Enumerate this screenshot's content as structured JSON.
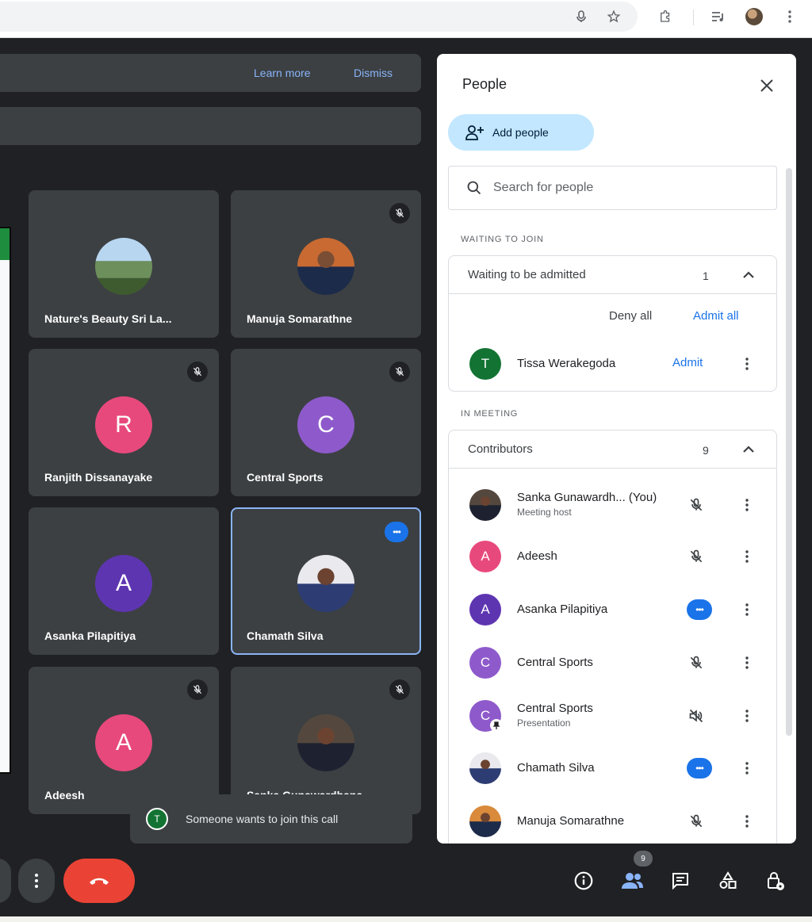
{
  "browser": {
    "icons": [
      "microphone-icon",
      "star-icon",
      "extensions-icon",
      "media-controls-icon",
      "profile-avatar",
      "menu-kebab-icon"
    ]
  },
  "banner": {
    "learn_more": "Learn more",
    "dismiss": "Dismiss"
  },
  "tiles": [
    {
      "name": "Nature's Beauty Sri La...",
      "avatar": "photo",
      "muted": false
    },
    {
      "name": "Manuja Somarathne",
      "avatar": "photo",
      "muted": true
    },
    {
      "name": "Ranjith Dissanayake",
      "initial": "R",
      "color": "#e8497c",
      "muted": true
    },
    {
      "name": "Central Sports",
      "initial": "C",
      "color": "#8e5acb",
      "muted": true
    },
    {
      "name": "Asanka Pilapitiya",
      "initial": "A",
      "color": "#5e35b1",
      "muted": false
    },
    {
      "name": "Chamath Silva",
      "avatar": "photo",
      "speaking": true,
      "active": true
    },
    {
      "name": "Adeesh",
      "initial": "A",
      "color": "#e8497c",
      "muted": true
    },
    {
      "name": "Sanka Gunawardhana",
      "avatar": "photo",
      "muted": true
    }
  ],
  "toast": {
    "initial": "T",
    "text": "Someone wants to join this call"
  },
  "controls": {
    "people_count": "9",
    "icons": [
      "info-icon",
      "people-icon",
      "chat-icon",
      "activities-icon",
      "host-controls-icon"
    ],
    "end_call_color": "#ea4335"
  },
  "people_panel": {
    "title": "People",
    "add_people": "Add people",
    "search_placeholder": "Search for people",
    "waiting_label": "WAITING TO JOIN",
    "waiting_group": {
      "label": "Waiting to be admitted",
      "count": "1"
    },
    "deny_all": "Deny all",
    "admit_all": "Admit all",
    "waiting": [
      {
        "initial": "T",
        "name": "Tissa Werakegoda",
        "action": "Admit",
        "color": "#137333"
      }
    ],
    "in_meeting_label": "IN MEETING",
    "contributors_group": {
      "label": "Contributors",
      "count": "9"
    },
    "participants": [
      {
        "name": "Sanka Gunawardh... (You)",
        "sub": "Meeting host",
        "avatar": "photo",
        "status": "muted"
      },
      {
        "name": "Adeesh",
        "initial": "A",
        "color": "#e8497c",
        "status": "muted"
      },
      {
        "name": "Asanka Pilapitiya",
        "initial": "A",
        "color": "#5e35b1",
        "status": "speaking"
      },
      {
        "name": "Central Sports",
        "initial": "C",
        "color": "#8e5acb",
        "status": "muted"
      },
      {
        "name": "Central Sports",
        "sub": "Presentation",
        "initial": "C",
        "color": "#8e5acb",
        "status": "presenting"
      },
      {
        "name": "Chamath Silva",
        "avatar": "photo",
        "status": "speaking"
      },
      {
        "name": "Manuja Somarathne",
        "avatar": "photo",
        "status": "muted"
      }
    ]
  }
}
